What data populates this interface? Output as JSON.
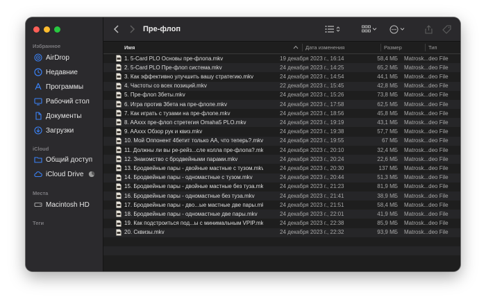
{
  "toolbar": {
    "title": "Пре-флоп"
  },
  "sidebar": {
    "sections": [
      {
        "title": "Избранное",
        "items": [
          {
            "label": "AirDrop",
            "icon": "airdrop-icon"
          },
          {
            "label": "Недавние",
            "icon": "clock-icon"
          },
          {
            "label": "Программы",
            "icon": "apps-icon"
          },
          {
            "label": "Рабочий стол",
            "icon": "desktop-icon"
          },
          {
            "label": "Документы",
            "icon": "document-icon"
          },
          {
            "label": "Загрузки",
            "icon": "download-icon"
          }
        ]
      },
      {
        "title": "iCloud",
        "items": [
          {
            "label": "Общий доступ",
            "icon": "shared-folder-icon"
          },
          {
            "label": "iCloud Drive",
            "icon": "cloud-icon"
          }
        ]
      },
      {
        "title": "Места",
        "items": [
          {
            "label": "Macintosh HD",
            "icon": "drive-icon"
          }
        ]
      },
      {
        "title": "Теги",
        "items": []
      }
    ]
  },
  "columns": {
    "name": "Имя",
    "date": "Дата изменения",
    "size": "Размер",
    "type": "Тип"
  },
  "files": [
    {
      "name": "1. 5-Card PLO Основы пре-флопа.mkv",
      "date": "19 декабря 2023 г., 16:14",
      "size": "58,4 МБ",
      "type": "Matrosk...deo File"
    },
    {
      "name": "2. 5-Card PLO Пре-флоп система.mkv",
      "date": "24 декабря 2023 г., 14:25",
      "size": "65,2 МБ",
      "type": "Matrosk...deo File"
    },
    {
      "name": "3. Как эффективно улучшить вашу стратегию.mkv",
      "date": "24 декабря 2023 г., 14:54",
      "size": "44,1 МБ",
      "type": "Matrosk...deo File"
    },
    {
      "name": "4. Частоты со всех позиций.mkv",
      "date": "22 декабря 2023 г., 15:45",
      "size": "42,8 МБ",
      "type": "Matrosk...deo File"
    },
    {
      "name": "5. Пре-флоп 3беты.mkv",
      "date": "24 декабря 2023 г., 15:26",
      "size": "73,8 МБ",
      "type": "Matrosk...deo File"
    },
    {
      "name": "6. Игра против 3бета на пре-флопе.mkv",
      "date": "24 декабря 2023 г., 17:58",
      "size": "62,5 МБ",
      "type": "Matrosk...deo File"
    },
    {
      "name": "7. Как играть с тузами на пре-флопе.mkv",
      "date": "24 декабря 2023 г., 18:56",
      "size": "45,8 МБ",
      "type": "Matrosk...deo File"
    },
    {
      "name": "8. AAxxx пре-флоп стретегия Omaha5 PLO.mkv",
      "date": "24 декабря 2023 г., 19:19",
      "size": "43,1 МБ",
      "type": "Matrosk...deo File"
    },
    {
      "name": "9. AAxxx Обзор рук и квиз.mkv",
      "date": "24 декабря 2023 г., 19:38",
      "size": "57,7 МБ",
      "type": "Matrosk...deo File"
    },
    {
      "name": "10. Мой Оппонент 4бетит только AA, что теперь?.mkv",
      "date": "24 декабря 2023 г., 19:55",
      "size": "67 МБ",
      "type": "Matrosk...deo File"
    },
    {
      "name": "11. Должны ли вы ре-рейз...сле колла пре-флопа?.mkv",
      "date": "24 декабря 2023 г., 20:10",
      "size": "32,4 МБ",
      "type": "Matrosk...deo File"
    },
    {
      "name": "12. Знакомство с бродвейными парами.mkv",
      "date": "24 декабря 2023 г., 20:24",
      "size": "22,6 МБ",
      "type": "Matrosk...deo File"
    },
    {
      "name": "13. Бродвейные пары - двойные мастные с тузом.mkv",
      "date": "24 декабря 2023 г., 20:30",
      "size": "137 МБ",
      "type": "Matrosk...deo File"
    },
    {
      "name": "14. Бродвейные пары - одномастные с тузом.mkv",
      "date": "24 декабря 2023 г., 20:44",
      "size": "51,3 МБ",
      "type": "Matrosk...deo File"
    },
    {
      "name": "15. Бродвейные пары - двойные мастные без туза.mkv",
      "date": "24 декабря 2023 г., 21:23",
      "size": "81,9 МБ",
      "type": "Matrosk...deo File"
    },
    {
      "name": "16. Бродвейные пары - одномастные без туза.mkv",
      "date": "24 декабря 2023 г., 21:41",
      "size": "38,9 МБ",
      "type": "Matrosk...deo File"
    },
    {
      "name": "17. Бродвейные пары - дво...ые мастные две пары.mkv",
      "date": "24 декабря 2023 г., 21:51",
      "size": "58,4 МБ",
      "type": "Matrosk...deo File"
    },
    {
      "name": "18. Бродвейные пары - одномастные две пары.mkv",
      "date": "24 декабря 2023 г., 22:01",
      "size": "41,9 МБ",
      "type": "Matrosk...deo File"
    },
    {
      "name": "19. Как подстроиться под...ы с минимальным VPIP.mkv",
      "date": "24 декабря 2023 г., 22:38",
      "size": "85,9 МБ",
      "type": "Matrosk...deo File"
    },
    {
      "name": "20. Сквизы.mkv",
      "date": "24 декабря 2023 г., 22:32",
      "size": "93,9 МБ",
      "type": "Matrosk...deo File"
    }
  ],
  "colors": {
    "accent": "#3b82f6",
    "sidebar_bg": "#2b2a2d",
    "list_bg": "#1e1e1e",
    "row_alt": "#262628"
  }
}
